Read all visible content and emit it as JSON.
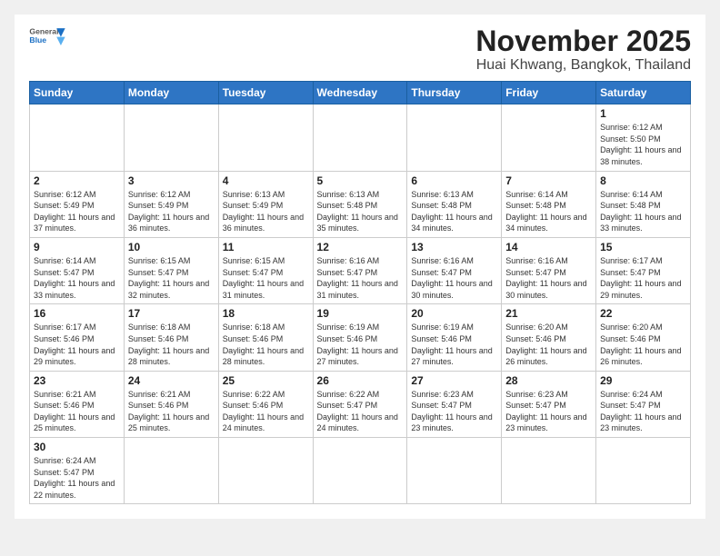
{
  "header": {
    "logo_general": "General",
    "logo_blue": "Blue",
    "month": "November 2025",
    "location": "Huai Khwang, Bangkok, Thailand"
  },
  "weekdays": [
    "Sunday",
    "Monday",
    "Tuesday",
    "Wednesday",
    "Thursday",
    "Friday",
    "Saturday"
  ],
  "days": {
    "d1": {
      "n": "1",
      "rise": "6:12 AM",
      "set": "5:50 PM",
      "day": "11 hours and 38 minutes."
    },
    "d2": {
      "n": "2",
      "rise": "6:12 AM",
      "set": "5:49 PM",
      "day": "11 hours and 37 minutes."
    },
    "d3": {
      "n": "3",
      "rise": "6:12 AM",
      "set": "5:49 PM",
      "day": "11 hours and 36 minutes."
    },
    "d4": {
      "n": "4",
      "rise": "6:13 AM",
      "set": "5:49 PM",
      "day": "11 hours and 36 minutes."
    },
    "d5": {
      "n": "5",
      "rise": "6:13 AM",
      "set": "5:48 PM",
      "day": "11 hours and 35 minutes."
    },
    "d6": {
      "n": "6",
      "rise": "6:13 AM",
      "set": "5:48 PM",
      "day": "11 hours and 34 minutes."
    },
    "d7": {
      "n": "7",
      "rise": "6:14 AM",
      "set": "5:48 PM",
      "day": "11 hours and 34 minutes."
    },
    "d8": {
      "n": "8",
      "rise": "6:14 AM",
      "set": "5:48 PM",
      "day": "11 hours and 33 minutes."
    },
    "d9": {
      "n": "9",
      "rise": "6:14 AM",
      "set": "5:47 PM",
      "day": "11 hours and 33 minutes."
    },
    "d10": {
      "n": "10",
      "rise": "6:15 AM",
      "set": "5:47 PM",
      "day": "11 hours and 32 minutes."
    },
    "d11": {
      "n": "11",
      "rise": "6:15 AM",
      "set": "5:47 PM",
      "day": "11 hours and 31 minutes."
    },
    "d12": {
      "n": "12",
      "rise": "6:16 AM",
      "set": "5:47 PM",
      "day": "11 hours and 31 minutes."
    },
    "d13": {
      "n": "13",
      "rise": "6:16 AM",
      "set": "5:47 PM",
      "day": "11 hours and 30 minutes."
    },
    "d14": {
      "n": "14",
      "rise": "6:16 AM",
      "set": "5:47 PM",
      "day": "11 hours and 30 minutes."
    },
    "d15": {
      "n": "15",
      "rise": "6:17 AM",
      "set": "5:47 PM",
      "day": "11 hours and 29 minutes."
    },
    "d16": {
      "n": "16",
      "rise": "6:17 AM",
      "set": "5:46 PM",
      "day": "11 hours and 29 minutes."
    },
    "d17": {
      "n": "17",
      "rise": "6:18 AM",
      "set": "5:46 PM",
      "day": "11 hours and 28 minutes."
    },
    "d18": {
      "n": "18",
      "rise": "6:18 AM",
      "set": "5:46 PM",
      "day": "11 hours and 28 minutes."
    },
    "d19": {
      "n": "19",
      "rise": "6:19 AM",
      "set": "5:46 PM",
      "day": "11 hours and 27 minutes."
    },
    "d20": {
      "n": "20",
      "rise": "6:19 AM",
      "set": "5:46 PM",
      "day": "11 hours and 27 minutes."
    },
    "d21": {
      "n": "21",
      "rise": "6:20 AM",
      "set": "5:46 PM",
      "day": "11 hours and 26 minutes."
    },
    "d22": {
      "n": "22",
      "rise": "6:20 AM",
      "set": "5:46 PM",
      "day": "11 hours and 26 minutes."
    },
    "d23": {
      "n": "23",
      "rise": "6:21 AM",
      "set": "5:46 PM",
      "day": "11 hours and 25 minutes."
    },
    "d24": {
      "n": "24",
      "rise": "6:21 AM",
      "set": "5:46 PM",
      "day": "11 hours and 25 minutes."
    },
    "d25": {
      "n": "25",
      "rise": "6:22 AM",
      "set": "5:46 PM",
      "day": "11 hours and 24 minutes."
    },
    "d26": {
      "n": "26",
      "rise": "6:22 AM",
      "set": "5:47 PM",
      "day": "11 hours and 24 minutes."
    },
    "d27": {
      "n": "27",
      "rise": "6:23 AM",
      "set": "5:47 PM",
      "day": "11 hours and 23 minutes."
    },
    "d28": {
      "n": "28",
      "rise": "6:23 AM",
      "set": "5:47 PM",
      "day": "11 hours and 23 minutes."
    },
    "d29": {
      "n": "29",
      "rise": "6:24 AM",
      "set": "5:47 PM",
      "day": "11 hours and 23 minutes."
    },
    "d30": {
      "n": "30",
      "rise": "6:24 AM",
      "set": "5:47 PM",
      "day": "11 hours and 22 minutes."
    }
  },
  "labels": {
    "sunrise": "Sunrise:",
    "sunset": "Sunset:",
    "daylight": "Daylight:"
  }
}
